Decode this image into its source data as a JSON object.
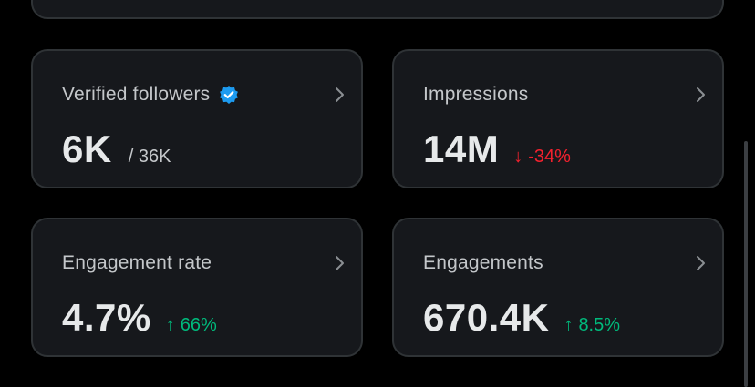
{
  "cards": [
    {
      "label": "Verified followers",
      "value": "6K",
      "sub": "/ 36K",
      "badge_icon": "verified-badge-icon",
      "badge_color": "#1d9bf0"
    },
    {
      "label": "Impressions",
      "value": "14M",
      "change_arrow": "↓",
      "change_text": "-34%",
      "change_color": "#f4212e"
    },
    {
      "label": "Engagement rate",
      "value": "4.7%",
      "change_arrow": "↑",
      "change_text": "66%",
      "change_color": "#00ba7c"
    },
    {
      "label": "Engagements",
      "value": "670.4K",
      "change_arrow": "↑",
      "change_text": "8.5%",
      "change_color": "#00ba7c"
    }
  ],
  "icons": {
    "chevron": "chevron-right-icon",
    "verified": "verified-badge-icon"
  },
  "colors": {
    "background": "#000000",
    "card_background": "#16181c",
    "card_border": "#2f3336",
    "text_primary": "#e7e9ea",
    "text_secondary": "#c4c7ca"
  }
}
